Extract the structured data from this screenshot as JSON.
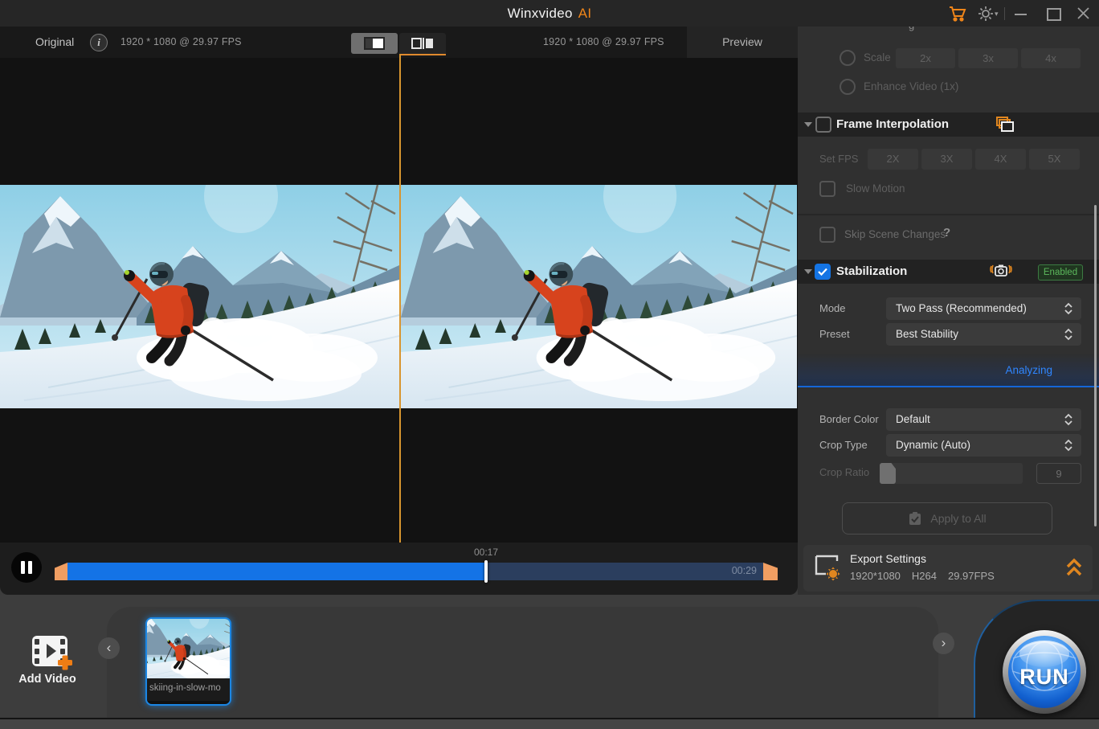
{
  "titlebar": {
    "title": "Winxvideo",
    "title_accent": "AI"
  },
  "preview": {
    "original_tab": "Original",
    "left_resolution": "1920 * 1080 @ 29.97 FPS",
    "right_resolution": "1920 * 1080 @ 29.97 FPS",
    "preview_tab": "Preview"
  },
  "player": {
    "current_time": "00:17",
    "total_time": "00:29",
    "progress_pct": 60.2
  },
  "panel": {
    "scale": {
      "label": "Scale",
      "options": [
        "2x",
        "3x",
        "4x"
      ]
    },
    "enhance_label": "Enhance Video (1x)",
    "frame_interpolation": {
      "title": "Frame Interpolation",
      "set_fps_label": "Set FPS",
      "fps_options": [
        "2X",
        "3X",
        "4X",
        "5X"
      ],
      "slow_motion_label": "Slow Motion",
      "skip_scene_label": "Skip Scene Changes"
    },
    "stabilization": {
      "title": "Stabilization",
      "status_badge": "Enabled",
      "mode_label": "Mode",
      "mode_value": "Two Pass (Recommended)",
      "preset_label": "Preset",
      "preset_value": "Best Stability",
      "analyzing_label": "Analyzing",
      "border_color_label": "Border Color",
      "border_color_value": "Default",
      "crop_type_label": "Crop Type",
      "crop_type_value": "Dynamic (Auto)",
      "crop_ratio_label": "Crop Ratio",
      "crop_ratio_value": "9"
    },
    "apply_to_all_label": "Apply to All",
    "export": {
      "title": "Export Settings",
      "resolution": "1920*1080",
      "codec": "H264",
      "fps": "29.97FPS"
    }
  },
  "bottom": {
    "add_video_label": "Add Video",
    "clip_name": "skiing-in-slow-mo",
    "run_label": "RUN"
  },
  "icons": {
    "info_glyph": "i",
    "help_glyph": "?",
    "nav_left_glyph": "‹",
    "nav_right_glyph": "›",
    "gear_caret_glyph": "▾"
  },
  "colors": {
    "accent_orange": "#f08519",
    "accent_blue": "#1473e6",
    "enabled_green": "#5cb85c",
    "analyzing_blue": "#2f86ff"
  }
}
